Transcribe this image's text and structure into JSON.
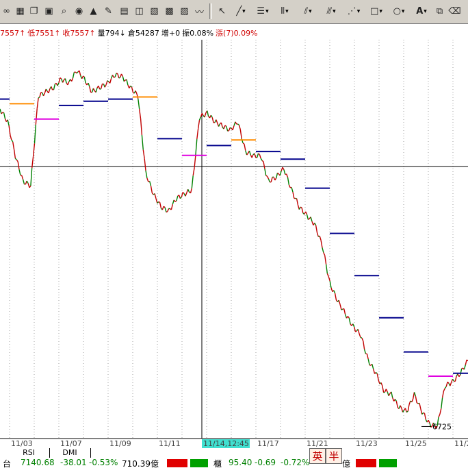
{
  "toolbar": {
    "icons": [
      "binoculars-icon",
      "chart-icon",
      "copy-icon",
      "book-icon",
      "search-chart-icon",
      "alert-icon",
      "warning-icon",
      "pencil-icon",
      "window-icon",
      "tile-icon",
      "dual-icon",
      "layout-icon",
      "picture-icon",
      "cursor-icon",
      "line-tool-icon",
      "fib-icon",
      "bars-icon",
      "fan-icon",
      "channel-icon",
      "parallel-icon",
      "rect-icon",
      "ellipse-icon",
      "text-icon",
      "copy-draw-icon",
      "eraser-icon"
    ]
  },
  "quote": {
    "high": "7557↑",
    "low": "低7551↑",
    "close": "收7557↑",
    "volume": "量794↓",
    "open_interest": "倉54287",
    "change_oi": "增+0",
    "amplitude": "振0.08%",
    "rise": "漲(7)0.09%"
  },
  "chart_data": {
    "type": "line",
    "x_tick_labels": [
      "11/03",
      "11/07",
      "11/09",
      "11/11",
      "11/14,12:45",
      "11/17",
      "11/21",
      "11/23",
      "11/25",
      "11/2"
    ],
    "cursor_label": "11/14,12:45",
    "low_annotation": "6725",
    "grid": "vertical dotted",
    "series": [
      {
        "name": "price",
        "values": [
          7470,
          7440,
          7360,
          7300,
          7290,
          7500,
          7510,
          7520,
          7540,
          7530,
          7560,
          7540,
          7510,
          7520,
          7530,
          7550,
          7545,
          7520,
          7500,
          7320,
          7270,
          7240,
          7230,
          7260,
          7270,
          7280,
          7450,
          7460,
          7440,
          7430,
          7420,
          7440,
          7370,
          7360,
          7360,
          7300,
          7310,
          7330,
          7280,
          7240,
          7220,
          7200,
          7150,
          7060,
          7020,
          6990,
          6960,
          6940,
          6880,
          6850,
          6810,
          6800,
          6770,
          6760,
          6800,
          6760,
          6730,
          6725,
          6820,
          6830,
          6850,
          6880
        ]
      }
    ],
    "segments": [
      {
        "day": "blue",
        "values": [
          7493,
          7488,
          7478,
          7493,
          7498
        ]
      },
      {
        "day": "orange",
        "values": [
          7482,
          7498
        ]
      },
      {
        "day": "magenta",
        "values": [
          7446,
          7361
        ]
      }
    ]
  },
  "bottom_tabs": [
    "RSI",
    "DMI"
  ],
  "ime": {
    "lang": "英",
    "width": "半"
  },
  "status": {
    "index_label": "台",
    "index_value": "7140.68",
    "index_change": "-38.01",
    "index_pct": "-0.53%",
    "index_vol": "710.39億",
    "sub_label": "櫃",
    "sub_value": "95.40",
    "sub_change": "-0.69",
    "sub_pct": "-0.72%",
    "sub_vol": "億"
  }
}
